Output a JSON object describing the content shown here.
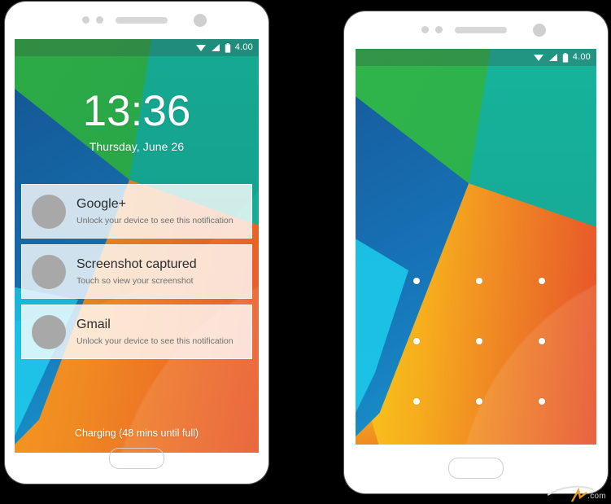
{
  "scene": {
    "background_color": "#000000",
    "watermark": ".com"
  },
  "phones": [
    {
      "id": "phone-lockscreen-notifications",
      "status_bar": {
        "wifi_icon": "wifi-icon",
        "signal_icon": "signal-bars-icon",
        "battery_icon": "battery-icon",
        "time_label": "4.00"
      },
      "clock": {
        "time": "13:36",
        "date": "Thursday, June 26"
      },
      "notifications": [
        {
          "avatar": "avatar-placeholder",
          "title": "Google+",
          "subtitle": "Unlock your device to see this notification"
        },
        {
          "avatar": "avatar-placeholder",
          "title": "Screenshot captured",
          "subtitle": "Touch so view your screenshot"
        },
        {
          "avatar": "avatar-placeholder",
          "title": "Gmail",
          "subtitle": "Unlock your device to see this notification"
        }
      ],
      "charging_status": "Charging (48 mins until full)"
    },
    {
      "id": "phone-pattern-lock",
      "status_bar": {
        "wifi_icon": "wifi-icon",
        "signal_icon": "signal-bars-icon",
        "battery_icon": "battery-icon",
        "time_label": "4.00"
      },
      "pattern_lock": {
        "rows": 3,
        "columns": 3,
        "dot_color": "#ffffff",
        "dots": [
          "dot-1",
          "dot-2",
          "dot-3",
          "dot-4",
          "dot-5",
          "dot-6",
          "dot-7",
          "dot-8",
          "dot-9"
        ]
      }
    }
  ],
  "wallpaper_colors": {
    "green": "#2fb54a",
    "teal": "#17b39a",
    "blue": "#1565a8",
    "cyan": "#19b9e3",
    "yellow": "#f7e31a",
    "orange": "#f5a91c",
    "red_orange": "#e8502a"
  },
  "chrome_colors": {
    "body": "#ffffff",
    "hardware": "#d2d2d2",
    "home_button_border": "#cfcfcf"
  }
}
